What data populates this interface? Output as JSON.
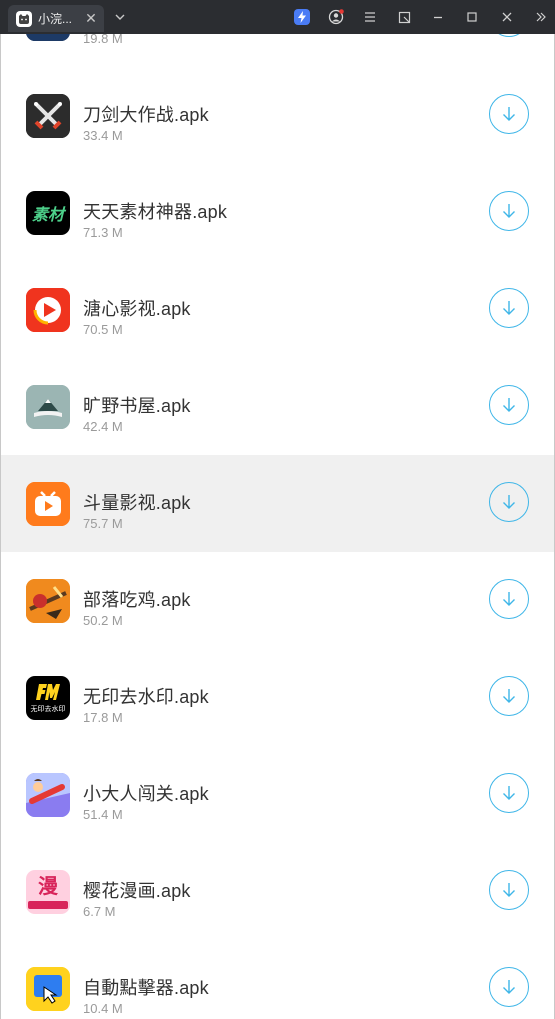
{
  "window": {
    "tab_title": "小浣...",
    "tab_close": "✕",
    "tab_dropdown": "⌄"
  },
  "apps": [
    {
      "name": "",
      "size": "19.8 M",
      "icon": "space-game-icon",
      "color": "#1d3a66"
    },
    {
      "name": "刀剑大作战.apk",
      "size": "33.4 M",
      "icon": "crossed-swords-icon",
      "color": "#2a2a2a"
    },
    {
      "name": "天天素材神器.apk",
      "size": "71.3 M",
      "icon": "sucai-logo-icon",
      "color": "#000000",
      "icon_text": "素材"
    },
    {
      "name": "溏心影视.apk",
      "size": "70.5 M",
      "icon": "play-video-icon",
      "color": "#f0341e"
    },
    {
      "name": "旷野书屋.apk",
      "size": "42.4 M",
      "icon": "book-mountain-icon",
      "color": "#9bb5b3"
    },
    {
      "name": "斗量影视.apk",
      "size": "75.7 M",
      "icon": "tv-play-icon",
      "color": "#ff7b1c"
    },
    {
      "name": "部落吃鸡.apk",
      "size": "50.2 M",
      "icon": "battle-game-icon",
      "color": "#f08a1e"
    },
    {
      "name": "无印去水印.apk",
      "size": "17.8 M",
      "icon": "watermark-remover-icon",
      "color": "#000000",
      "icon_text": "无印去水印"
    },
    {
      "name": "小大人闯关.apk",
      "size": "51.4 M",
      "icon": "runner-game-icon",
      "color": "#8a7cf0"
    },
    {
      "name": "樱花漫画.apk",
      "size": "6.7 M",
      "icon": "manga-icon",
      "color": "#ffd0e0",
      "icon_text": "漫"
    },
    {
      "name": "自動點擊器.apk",
      "size": "10.4 M",
      "icon": "auto-clicker-icon",
      "color": "#ffd21e"
    }
  ],
  "highlighted_row": 5,
  "accent_color": "#3fb6e8"
}
